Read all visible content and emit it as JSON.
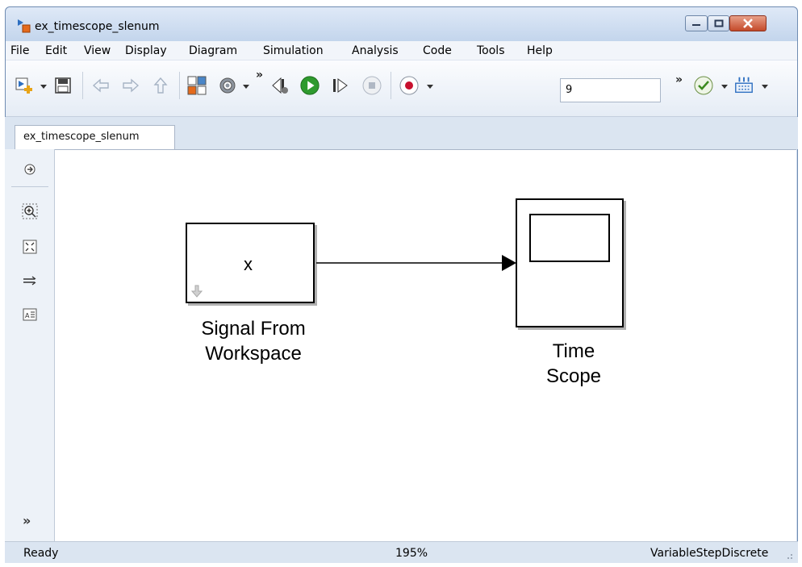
{
  "window": {
    "title": "ex_timescope_slenum"
  },
  "menu": [
    "File",
    "Edit",
    "View",
    "Display",
    "Diagram",
    "Simulation",
    "Analysis",
    "Code",
    "Tools",
    "Help"
  ],
  "toolbar": {
    "stop_time": "9",
    "chevron": "»",
    "icons": [
      "new-model-icon",
      "save-icon",
      "back-icon",
      "forward-icon",
      "up-icon",
      "library-browser-icon",
      "settings-icon",
      "step-back-icon",
      "run-icon",
      "step-forward-icon",
      "stop-icon",
      "record-icon",
      "check-icon",
      "build-icon"
    ]
  },
  "tabs": [
    {
      "label": "ex_timescope_slenum"
    }
  ],
  "palette": {
    "more": "»"
  },
  "diagram": {
    "blocks": [
      {
        "name": "signal-from-workspace",
        "inner_text": "x",
        "label_line1": "Signal From",
        "label_line2": "Workspace"
      },
      {
        "name": "time-scope",
        "label_line1": "Time",
        "label_line2": "Scope"
      }
    ]
  },
  "status": {
    "left": "Ready",
    "zoom": "195%",
    "solver": "VariableStepDiscrete"
  },
  "colors": {
    "run": "#2e9a2e",
    "record": "#c8102e",
    "title_bar": "#c3d5ec",
    "close_button": "#c44a2a"
  }
}
